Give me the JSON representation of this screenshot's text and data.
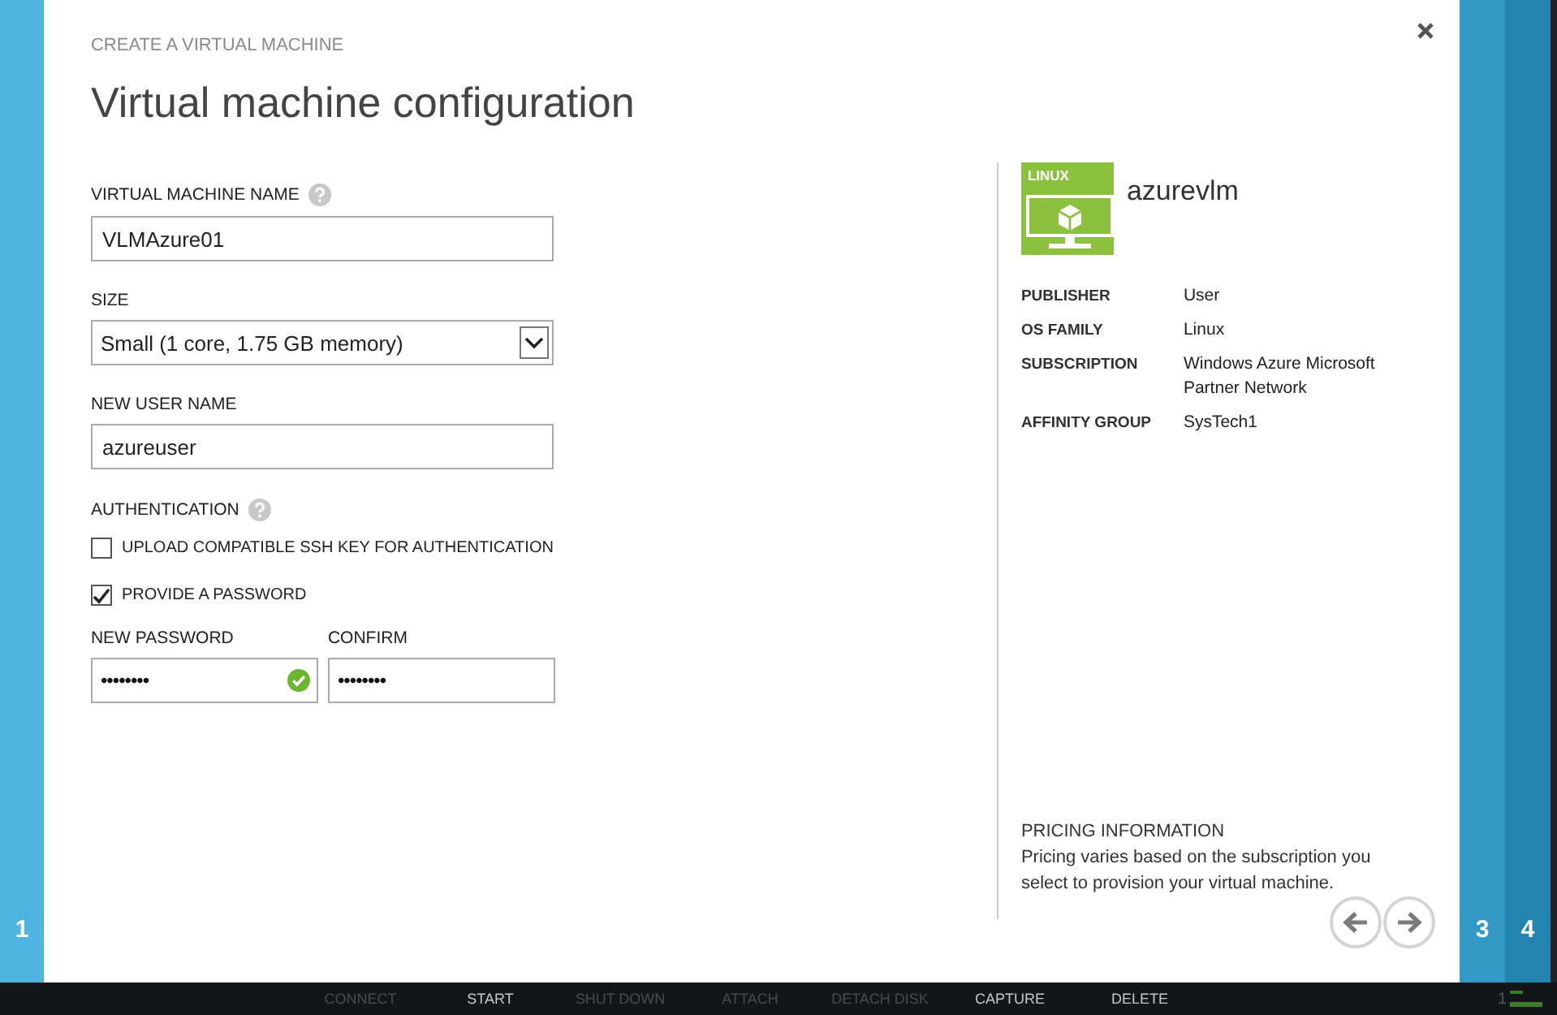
{
  "left_steps": [
    "1"
  ],
  "right_steps": [
    "3",
    "4"
  ],
  "dialog": {
    "header": "CREATE A VIRTUAL MACHINE",
    "title": "Virtual machine configuration",
    "vm_name": {
      "label": "VIRTUAL MACHINE NAME",
      "help": true,
      "value": "VLMAzure01"
    },
    "size": {
      "label": "SIZE",
      "value": "Small (1 core, 1.75 GB memory)"
    },
    "user_name": {
      "label": "NEW USER NAME",
      "value": "azureuser"
    },
    "authentication": {
      "label": "AUTHENTICATION",
      "help": true,
      "options": [
        {
          "label": "UPLOAD COMPATIBLE SSH KEY FOR AUTHENTICATION",
          "checked": false
        },
        {
          "label": "PROVIDE A PASSWORD",
          "checked": true
        }
      ]
    },
    "passwords": [
      {
        "label": "NEW PASSWORD",
        "value": "••••••••",
        "valid": true
      },
      {
        "label": "CONFIRM",
        "value": "••••••••",
        "valid": false
      }
    ]
  },
  "summary": {
    "badge": "LINUX",
    "name": "azurevlm",
    "properties": [
      {
        "label": "PUBLISHER",
        "value": "User"
      },
      {
        "label": "OS FAMILY",
        "value": "Linux"
      },
      {
        "label": "SUBSCRIPTION",
        "value": "Windows Azure Microsoft Partner Network"
      },
      {
        "label": "AFFINITY GROUP",
        "value": "SysTech1"
      }
    ],
    "pricing": {
      "heading": "PRICING INFORMATION",
      "text": "Pricing varies based on the subscription you select to provision your virtual machine."
    }
  },
  "command_bar": {
    "items": [
      {
        "label": "CONNECT",
        "disabled": true
      },
      {
        "label": "START",
        "disabled": false
      },
      {
        "label": "SHUT DOWN",
        "disabled": true
      },
      {
        "label": "ATTACH",
        "disabled": true
      },
      {
        "label": "DETACH DISK",
        "disabled": true
      },
      {
        "label": "CAPTURE",
        "disabled": false
      },
      {
        "label": "DELETE",
        "disabled": false
      }
    ],
    "count": "1"
  }
}
